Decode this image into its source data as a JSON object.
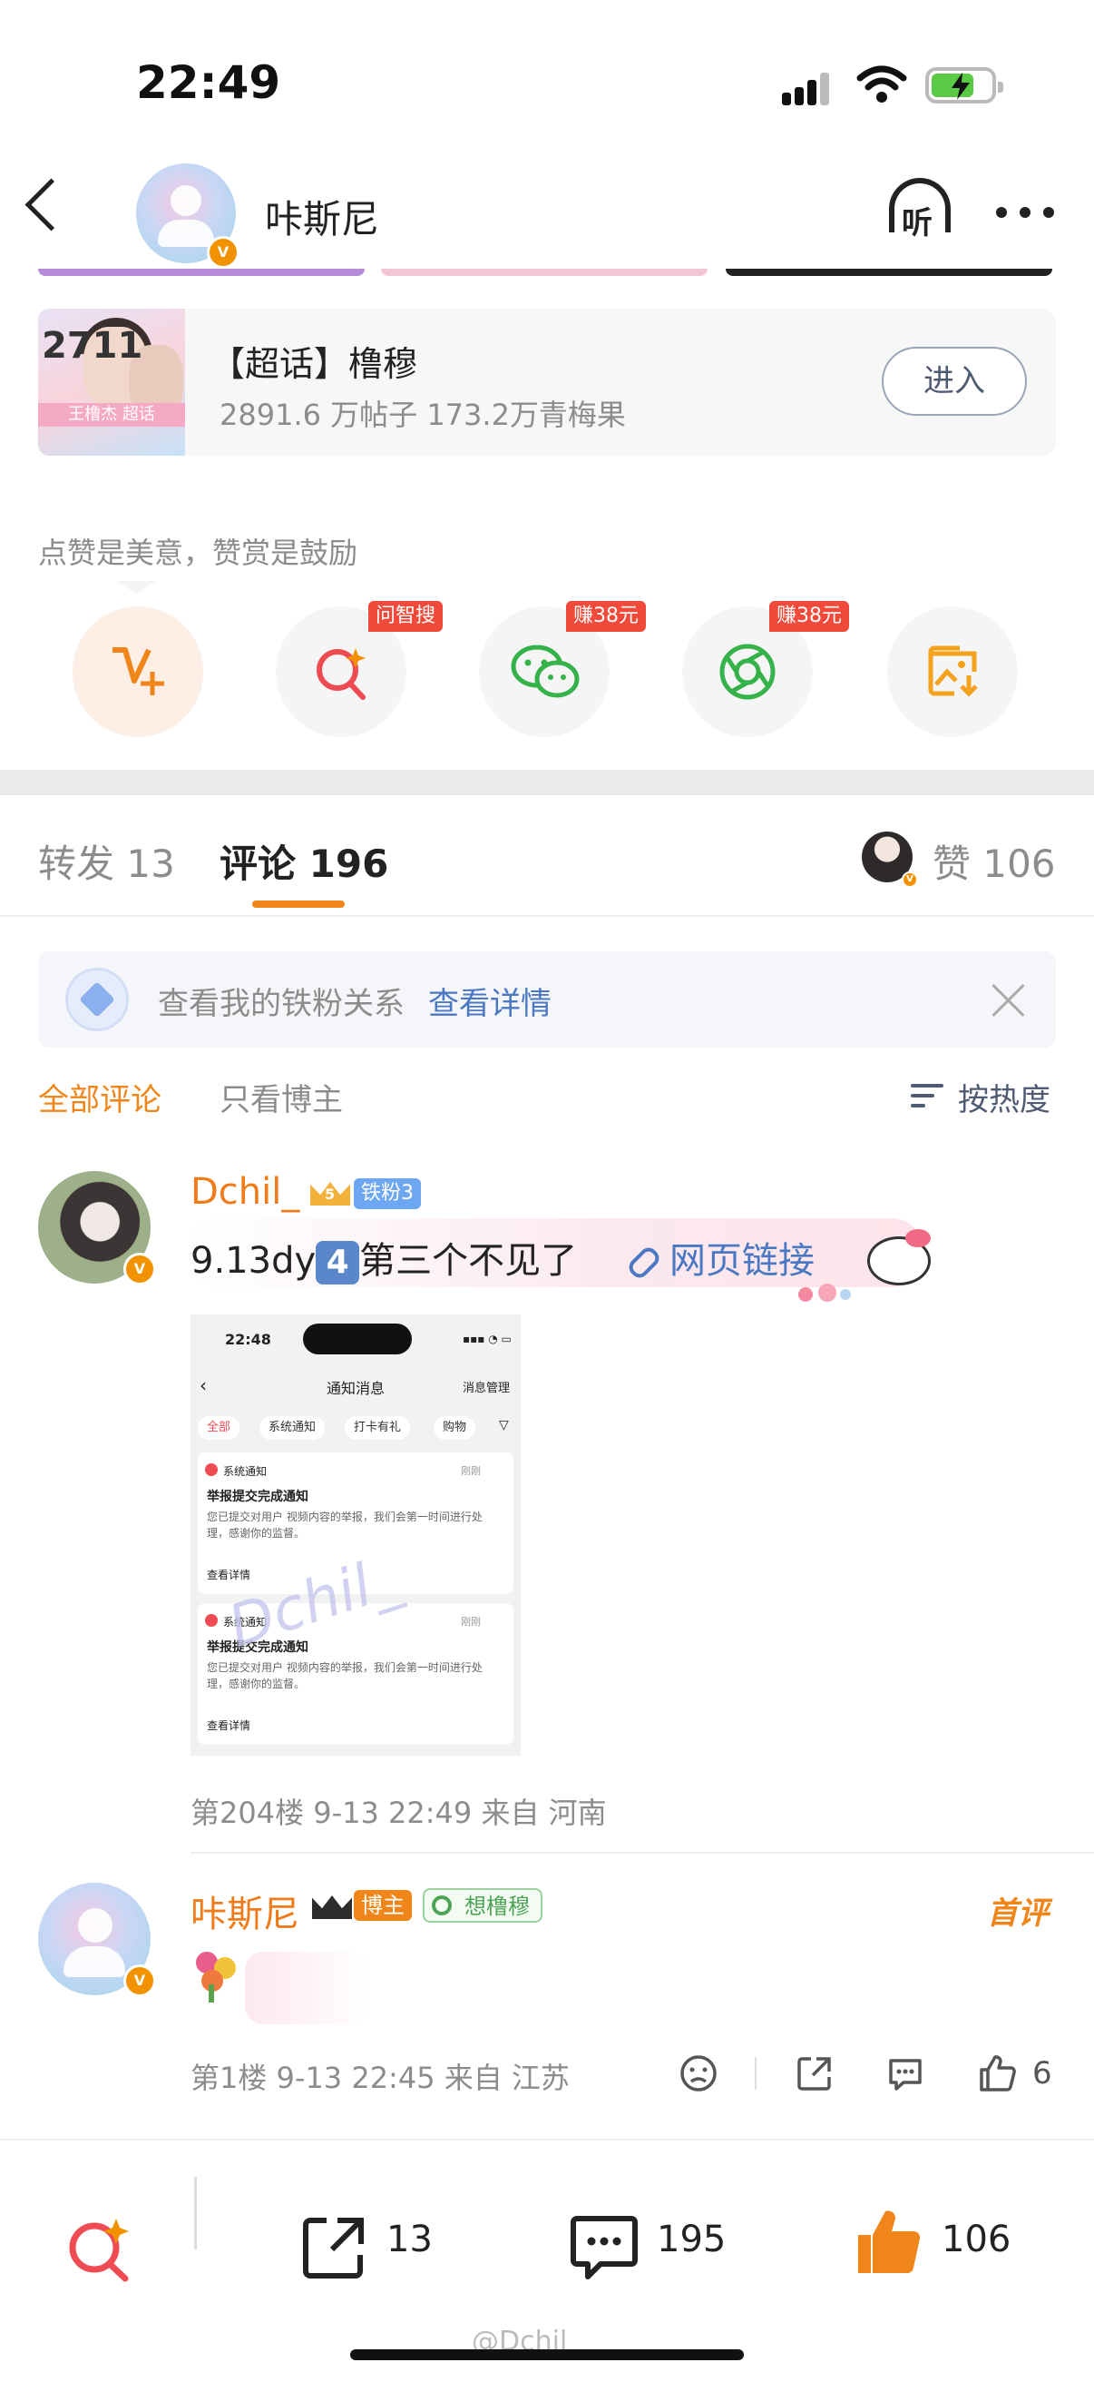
{
  "status_bar": {
    "time": "22:49"
  },
  "header": {
    "name": "咔斯尼",
    "listen_label": "听"
  },
  "super_topic": {
    "image_text": "2711",
    "image_banner": "王橹杰 超话",
    "title": "【超话】橹穆",
    "stats": "2891.6 万帖子 173.2万青梅果",
    "enter_label": "进入"
  },
  "like_hint": "点赞是美意，赞赏是鼓励",
  "tools": [
    {
      "icon": "v-plus-icon",
      "tag": ""
    },
    {
      "icon": "ai-search-icon",
      "tag": "问智搜"
    },
    {
      "icon": "wechat-icon",
      "tag": "赚38元"
    },
    {
      "icon": "moments-icon",
      "tag": "赚38元"
    },
    {
      "icon": "save-image-icon",
      "tag": ""
    }
  ],
  "tabs": {
    "repost": "转发 13",
    "comments": "评论 196",
    "likes": "赞 106"
  },
  "fan_banner": {
    "text": "查看我的铁粉关系",
    "link": "查看详情"
  },
  "filters": {
    "all": "全部评论",
    "blogger_only": "只看博主",
    "sort": "按热度"
  },
  "comments": [
    {
      "name": "Dchil_",
      "fan_badge": "铁粉3",
      "crown_level": "5",
      "text_before": "9.13dy",
      "emoji_num": "4",
      "text_after": "第三个不见了",
      "link": "网页链接",
      "meta": "第204楼  9-13 22:49  来自 河南",
      "screenshot": {
        "time": "22:48",
        "title": "通知消息",
        "manage": "消息管理",
        "pills": [
          "全部",
          "系统通知",
          "打卡有礼",
          "购物"
        ],
        "card1_source": "系统通知",
        "card1_title": "举报提交完成通知",
        "card1_body": "您已提交对用户          视频内容的举报，我们会第一时间进行处理，感谢你的监督。",
        "card1_time": "刚刚",
        "card2_source": "系统通知",
        "card2_title": "举报提交完成通知",
        "card2_body": "您已提交对用户          视频内容的举报，我们会第一时间进行处理，感谢你的监督。",
        "card2_time": "刚刚",
        "detail": "查看详情",
        "watermark": "Dchil_"
      }
    },
    {
      "name": "咔斯尼",
      "host_badge": "博主",
      "interest_badge": "想橹穆",
      "first_badge": "首评",
      "meta": "第1楼  9-13 22:45  来自 江苏",
      "like_count": "6"
    }
  ],
  "bottom_bar": {
    "reposts": "13",
    "comments": "195",
    "likes": "106"
  },
  "watermark": "@Dchil_",
  "colors": {
    "accent": "#f08519",
    "link": "#4a78c2",
    "verified": "#f39200"
  }
}
